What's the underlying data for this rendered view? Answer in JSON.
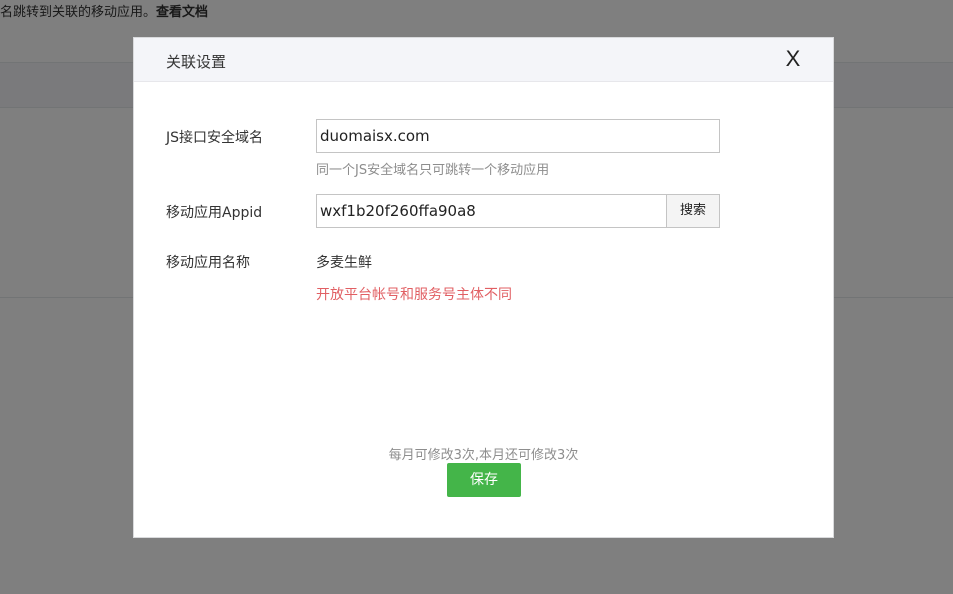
{
  "background": {
    "top_text": "名跳转到关联的移动应用。",
    "top_link": "查看文档"
  },
  "dialog": {
    "title": "关联设置",
    "close_label": "X",
    "js_domain": {
      "label": "JS接口安全域名",
      "value": "duomaisx.com",
      "hint": "同一个JS安全域名只可跳转一个移动应用"
    },
    "appid": {
      "label": "移动应用Appid",
      "value": "wxf1b20f260ffa90a8",
      "search_label": "搜索"
    },
    "app_name": {
      "label": "移动应用名称",
      "value": "多麦生鲜",
      "error": "开放平台帐号和服务号主体不同"
    },
    "footer_note": "每月可修改3次,本月还可修改3次",
    "save_label": "保存"
  }
}
